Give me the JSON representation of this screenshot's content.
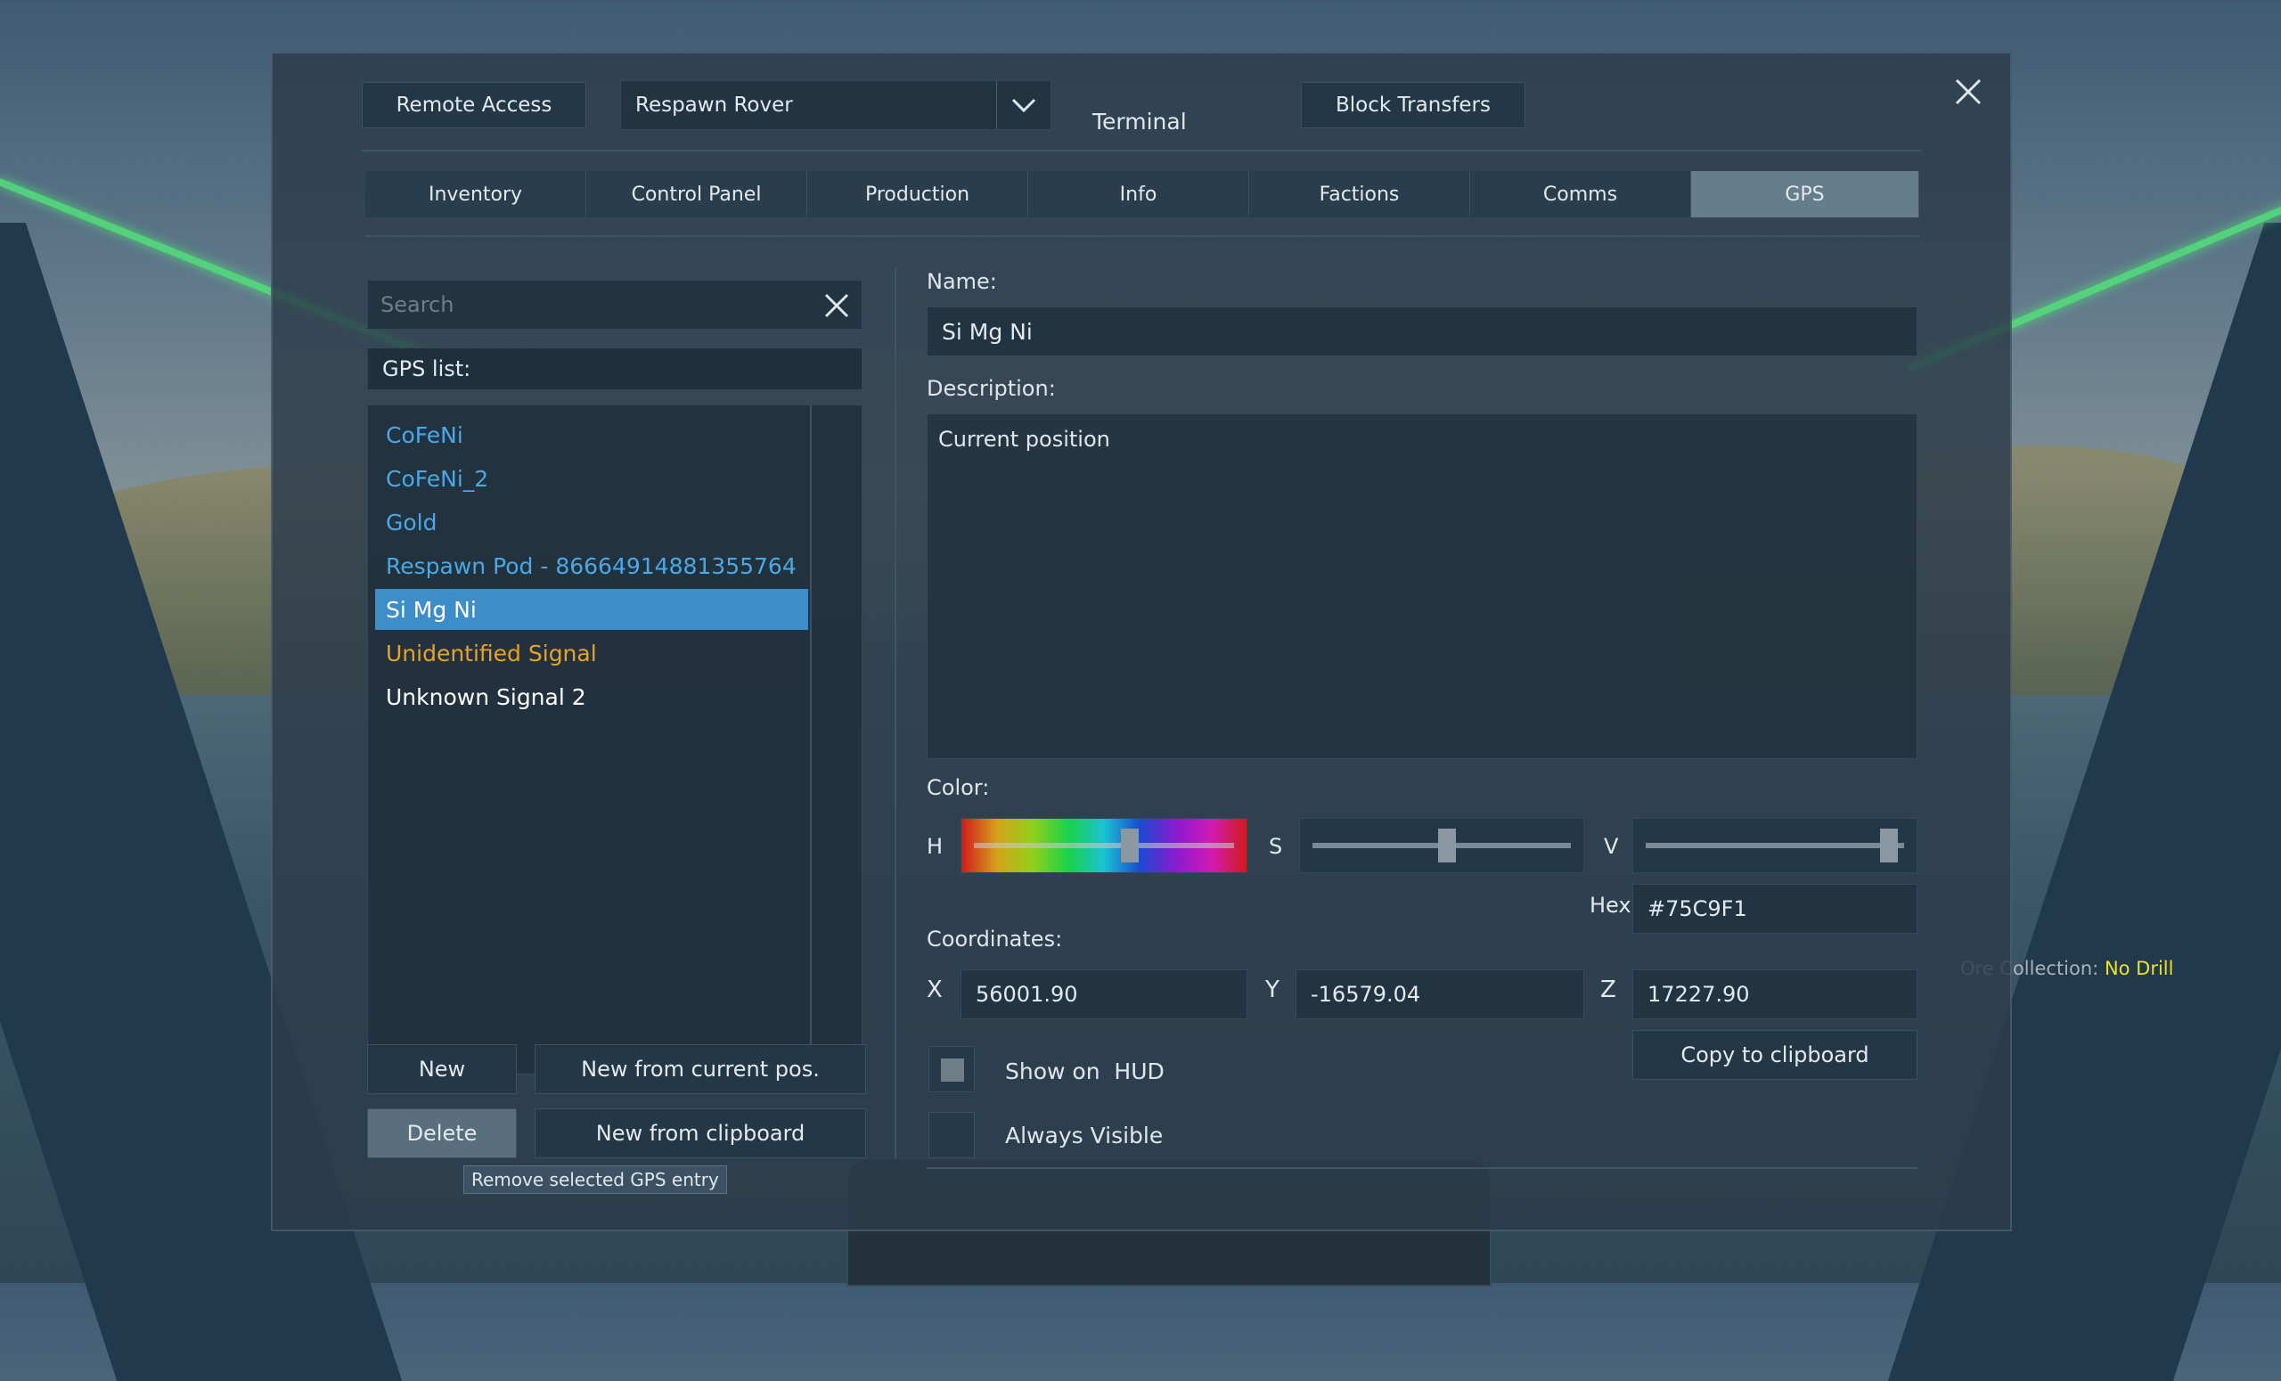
{
  "header": {
    "remote_access": "Remote Access",
    "grid_select": "Respawn Rover",
    "title": "Terminal",
    "block_transfers": "Block Transfers"
  },
  "tabs": [
    {
      "label": "Inventory"
    },
    {
      "label": "Control Panel"
    },
    {
      "label": "Production"
    },
    {
      "label": "Info"
    },
    {
      "label": "Factions"
    },
    {
      "label": "Comms"
    },
    {
      "label": "GPS",
      "active": true
    }
  ],
  "search": {
    "placeholder": "Search",
    "value": ""
  },
  "gps_list": {
    "header": "GPS list:",
    "items": [
      {
        "label": "CoFeNi",
        "color": "#4aa8e6"
      },
      {
        "label": "CoFeNi_2",
        "color": "#4aa8e6"
      },
      {
        "label": "Gold",
        "color": "#4aa8e6"
      },
      {
        "label": "Respawn Pod - 86664914881355764",
        "color": "#4aa8e6"
      },
      {
        "label": "Si Mg Ni",
        "color": "#ffffff",
        "selected": true
      },
      {
        "label": "Unidentified Signal",
        "color": "#e8a31f"
      },
      {
        "label": "Unknown Signal 2",
        "color": "#ffffff"
      }
    ]
  },
  "buttons": {
    "new": "New",
    "new_from_pos": "New from current pos.",
    "delete": "Delete",
    "new_from_clipboard": "New from clipboard",
    "tooltip": "Remove selected GPS entry",
    "copy_clipboard": "Copy to clipboard"
  },
  "detail": {
    "name_label": "Name:",
    "name_value": "Si Mg Ni",
    "description_label": "Description:",
    "description_value": "Current position",
    "color_label": "Color:",
    "h_label": "H",
    "s_label": "S",
    "v_label": "V",
    "h_value": 0.6,
    "s_value": 0.52,
    "v_value": 0.94,
    "hex_label": "Hex",
    "hex_value": "#75C9F1",
    "coords_label": "Coordinates:",
    "x_label": "X",
    "x_value": "56001.90",
    "y_label": "Y",
    "y_value": "-16579.04",
    "z_label": "Z",
    "z_value": "17227.90",
    "show_hud_label": "Show on  HUD",
    "always_visible_label": "Always Visible"
  },
  "hud": {
    "ore_label": "Ore Collection:",
    "ore_value": "No Drill"
  },
  "colors": {
    "accent_blue": "#3d8ec8",
    "list_blue": "#4aa8e6",
    "signal_orange": "#e8a31f",
    "laser_green": "#52e27a",
    "hud_yellow": "#f0e020"
  }
}
